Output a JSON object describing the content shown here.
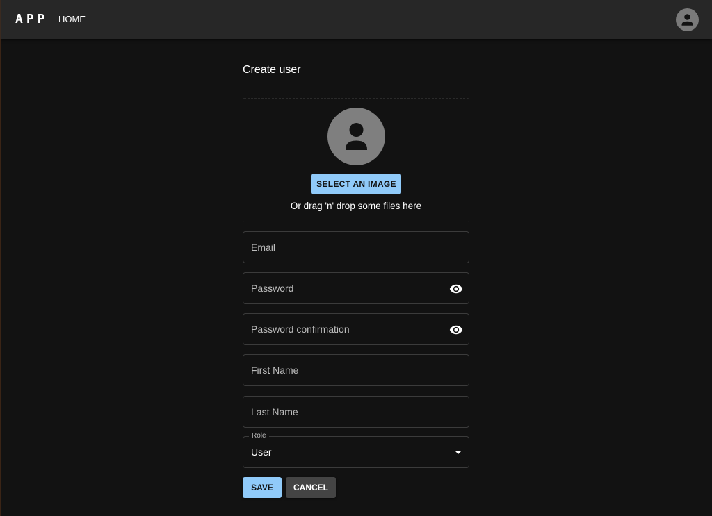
{
  "appbar": {
    "logo": "APP",
    "nav": [
      {
        "label": "HOME"
      }
    ],
    "account_icon": "account-circle-icon"
  },
  "page": {
    "title": "Create user"
  },
  "upload": {
    "avatar_icon": "person-icon",
    "button_label": "SELECT AN IMAGE",
    "hint": "Or drag 'n' drop some files here"
  },
  "form": {
    "fields": [
      {
        "label": "Email",
        "value": ""
      },
      {
        "label": "Password",
        "value": "",
        "icon": "eye-icon"
      },
      {
        "label": "Password confirmation",
        "value": "",
        "icon": "eye-icon"
      },
      {
        "label": "First Name",
        "value": ""
      },
      {
        "label": "Last Name",
        "value": ""
      }
    ],
    "role": {
      "label": "Role",
      "value": "User"
    },
    "save_label": "SAVE",
    "cancel_label": "CANCEL"
  },
  "colors": {
    "primary": "#90caf9",
    "appbar": "#272727",
    "background": "#121212"
  }
}
